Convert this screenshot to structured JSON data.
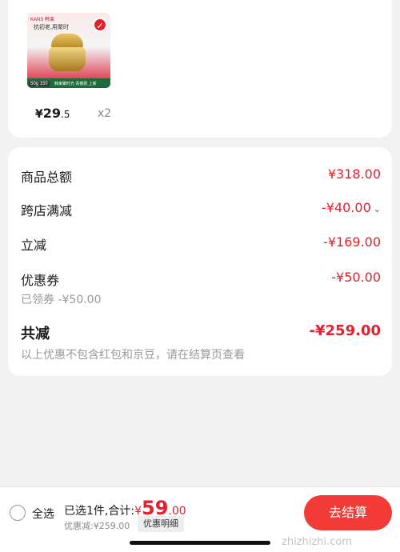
{
  "product": {
    "thumbnail": {
      "brand_text": "KANS 韩束",
      "slogan": "抗初老,用聚时",
      "size_tag": "50g 150",
      "bottom_text": "韩束聚时光 青春肌 上新",
      "badge_icon": "check-icon"
    },
    "price_currency": "¥",
    "price_int": "29",
    "price_dec": ".5",
    "quantity": "x2"
  },
  "summary": {
    "rows": [
      {
        "label": "商品总额",
        "value": "¥318.00"
      },
      {
        "label": "跨店满减",
        "value": "-¥40.00",
        "has_chevron": true
      },
      {
        "label": "立减",
        "value": "-¥169.00"
      },
      {
        "label": "优惠券",
        "value": "-¥50.00",
        "sub": "已领券 -¥50.00"
      }
    ],
    "total_label": "共减",
    "total_value": "-¥259.00",
    "note": "以上优惠不包含红包和京豆，请在结算页查看"
  },
  "bottom_bar": {
    "select_all": "全选",
    "selected_prefix": "已选1件,合计:",
    "currency": "¥",
    "total_int": "59",
    "total_dec": ".00",
    "discount_text": "优惠减:¥259.00",
    "detail_button": "优惠明细",
    "checkout_button": "去结算"
  },
  "watermark": "zhizhizhi.com",
  "colors": {
    "accent": "#e4202f",
    "checkout": "#f23b36",
    "background": "#f2f2f2"
  }
}
